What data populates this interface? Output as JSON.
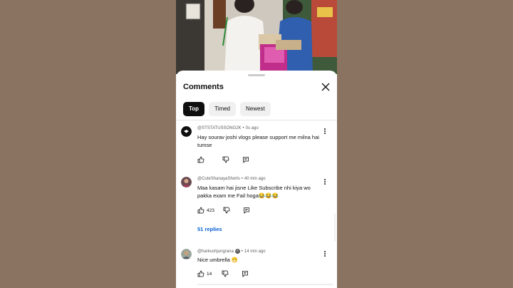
{
  "sheet": {
    "title": "Comments",
    "close_icon": "close-icon"
  },
  "chips": [
    {
      "label": "Top",
      "active": true
    },
    {
      "label": "Timed",
      "active": false
    },
    {
      "label": "Newest",
      "active": false
    }
  ],
  "comments": [
    {
      "author": "@STSTATUSSONG2K",
      "time": "0s ago",
      "text": "Hay sourav joshi vlogs please support me milna hai tumse",
      "likes": "",
      "replies": ""
    },
    {
      "author": "@CuteShanayaShorts",
      "time": "40 min ago",
      "text": "Maa kasam hai jisne Like Subscribe nhi kiya wo pakka exam me Fail hoga😂😂😂",
      "likes": "423",
      "replies": "51 replies"
    },
    {
      "author": "@harkushjungrana",
      "time": "14 min ago",
      "text": "Nice umbrella 😁",
      "likes": "14",
      "replies": ""
    }
  ],
  "colors": {
    "page_bg": "#8b7361",
    "link": "#065fd4",
    "chip_active": "#0f0f0f"
  }
}
